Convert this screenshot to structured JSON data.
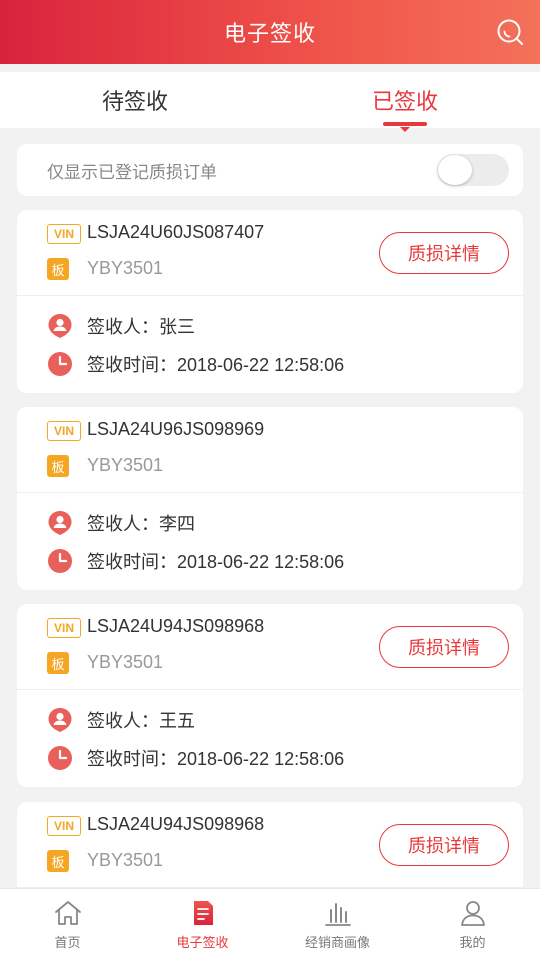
{
  "header": {
    "title": "电子签收"
  },
  "tabs": [
    {
      "label": "待签收"
    },
    {
      "label": "已签收"
    }
  ],
  "filter": {
    "label": "仅显示已登记质损订单"
  },
  "badges": {
    "vin": "VIN",
    "plate": "板"
  },
  "detail_label": "质损详情",
  "cards": [
    {
      "vin": "LSJA24U60JS087407",
      "plate": "YBY3501",
      "receiver": "签收人：张三",
      "time": "签收时间：2018-06-22 12:58:06"
    },
    {
      "vin": "LSJA24U96JS098969",
      "plate": "YBY3501",
      "receiver": "签收人：李四",
      "time": "签收时间：2018-06-22 12:58:06"
    },
    {
      "vin": "LSJA24U94JS098968",
      "plate": "YBY3501",
      "receiver": "签收人：王五",
      "time": "签收时间：2018-06-22 12:58:06"
    },
    {
      "vin": "LSJA24U94JS098968",
      "plate": "YBY3501"
    }
  ],
  "nav": [
    {
      "label": "首页",
      "icon": "home-icon"
    },
    {
      "label": "电子签收",
      "icon": "sign-document-icon"
    },
    {
      "label": "经销商画像",
      "icon": "bar-chart-icon"
    },
    {
      "label": "我的",
      "icon": "person-icon"
    }
  ],
  "colors": {
    "accent": "#e8383d",
    "badge": "#f5a623",
    "header_start": "#d9233d",
    "header_end": "#f4715a"
  }
}
